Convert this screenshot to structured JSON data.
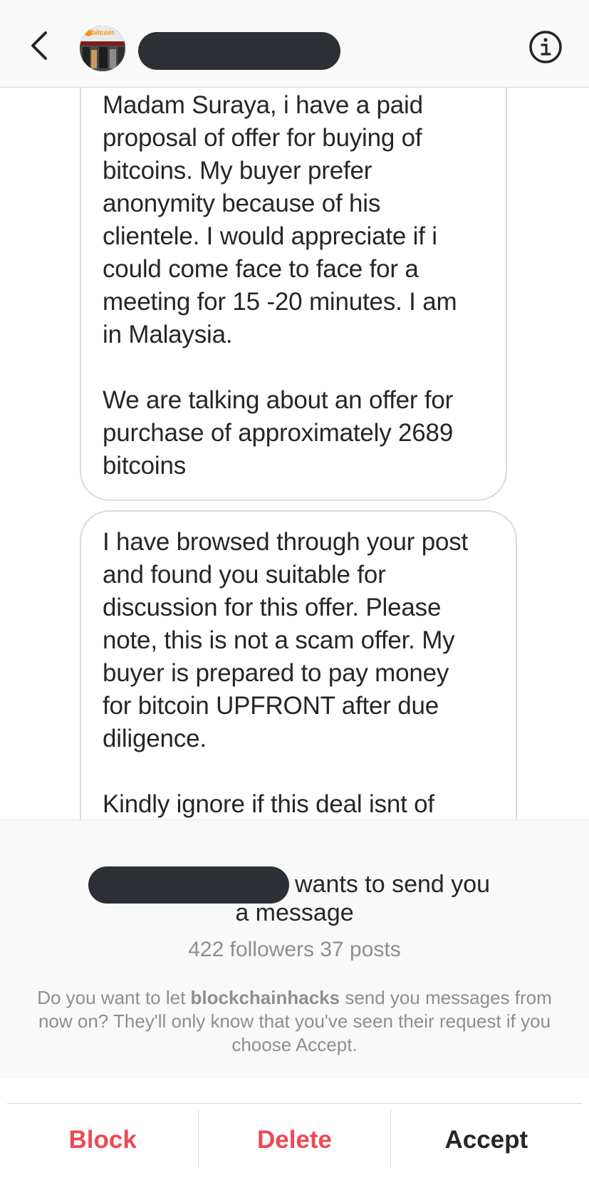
{
  "header": {
    "back_icon": "chevron-left-icon",
    "avatar_label": "bitcoin",
    "info_icon": "info-icon",
    "username": ""
  },
  "messages": [
    {
      "text": "Madam Suraya, i have a paid\nproposal of offer for buying of\nbitcoins. My buyer prefer\nanonymity because of his\nclientele. I would appreciate if i\ncould come face to face for a\nmeeting for 15 -20 minutes. I am\nin Malaysia.\n\nWe are talking about an offer for\npurchase of approximately 2689\nbitcoins"
    },
    {
      "text": "I have browsed through your post\nand found you suitable for\ndiscussion for this offer. Please\nnote, this is not a scam offer. My\nbuyer is prepared to pay money\nfor bitcoin UPFRONT after due\ndiligence.\n\nKindly ignore if this deal isnt of"
    }
  ],
  "request": {
    "wants_line1": "wants to send you",
    "wants_line2": "a message",
    "stats": "422 followers 37 posts",
    "note_prefix": "Do you want to let ",
    "note_username": "blockchainhacks",
    "note_suffix": " send you messages from now on? They'll only know that you've seen their request if you choose Accept."
  },
  "actions": {
    "block_label": "Block",
    "delete_label": "Delete",
    "accept_label": "Accept",
    "danger_color": "#ed4956",
    "primary_color": "#262626"
  }
}
